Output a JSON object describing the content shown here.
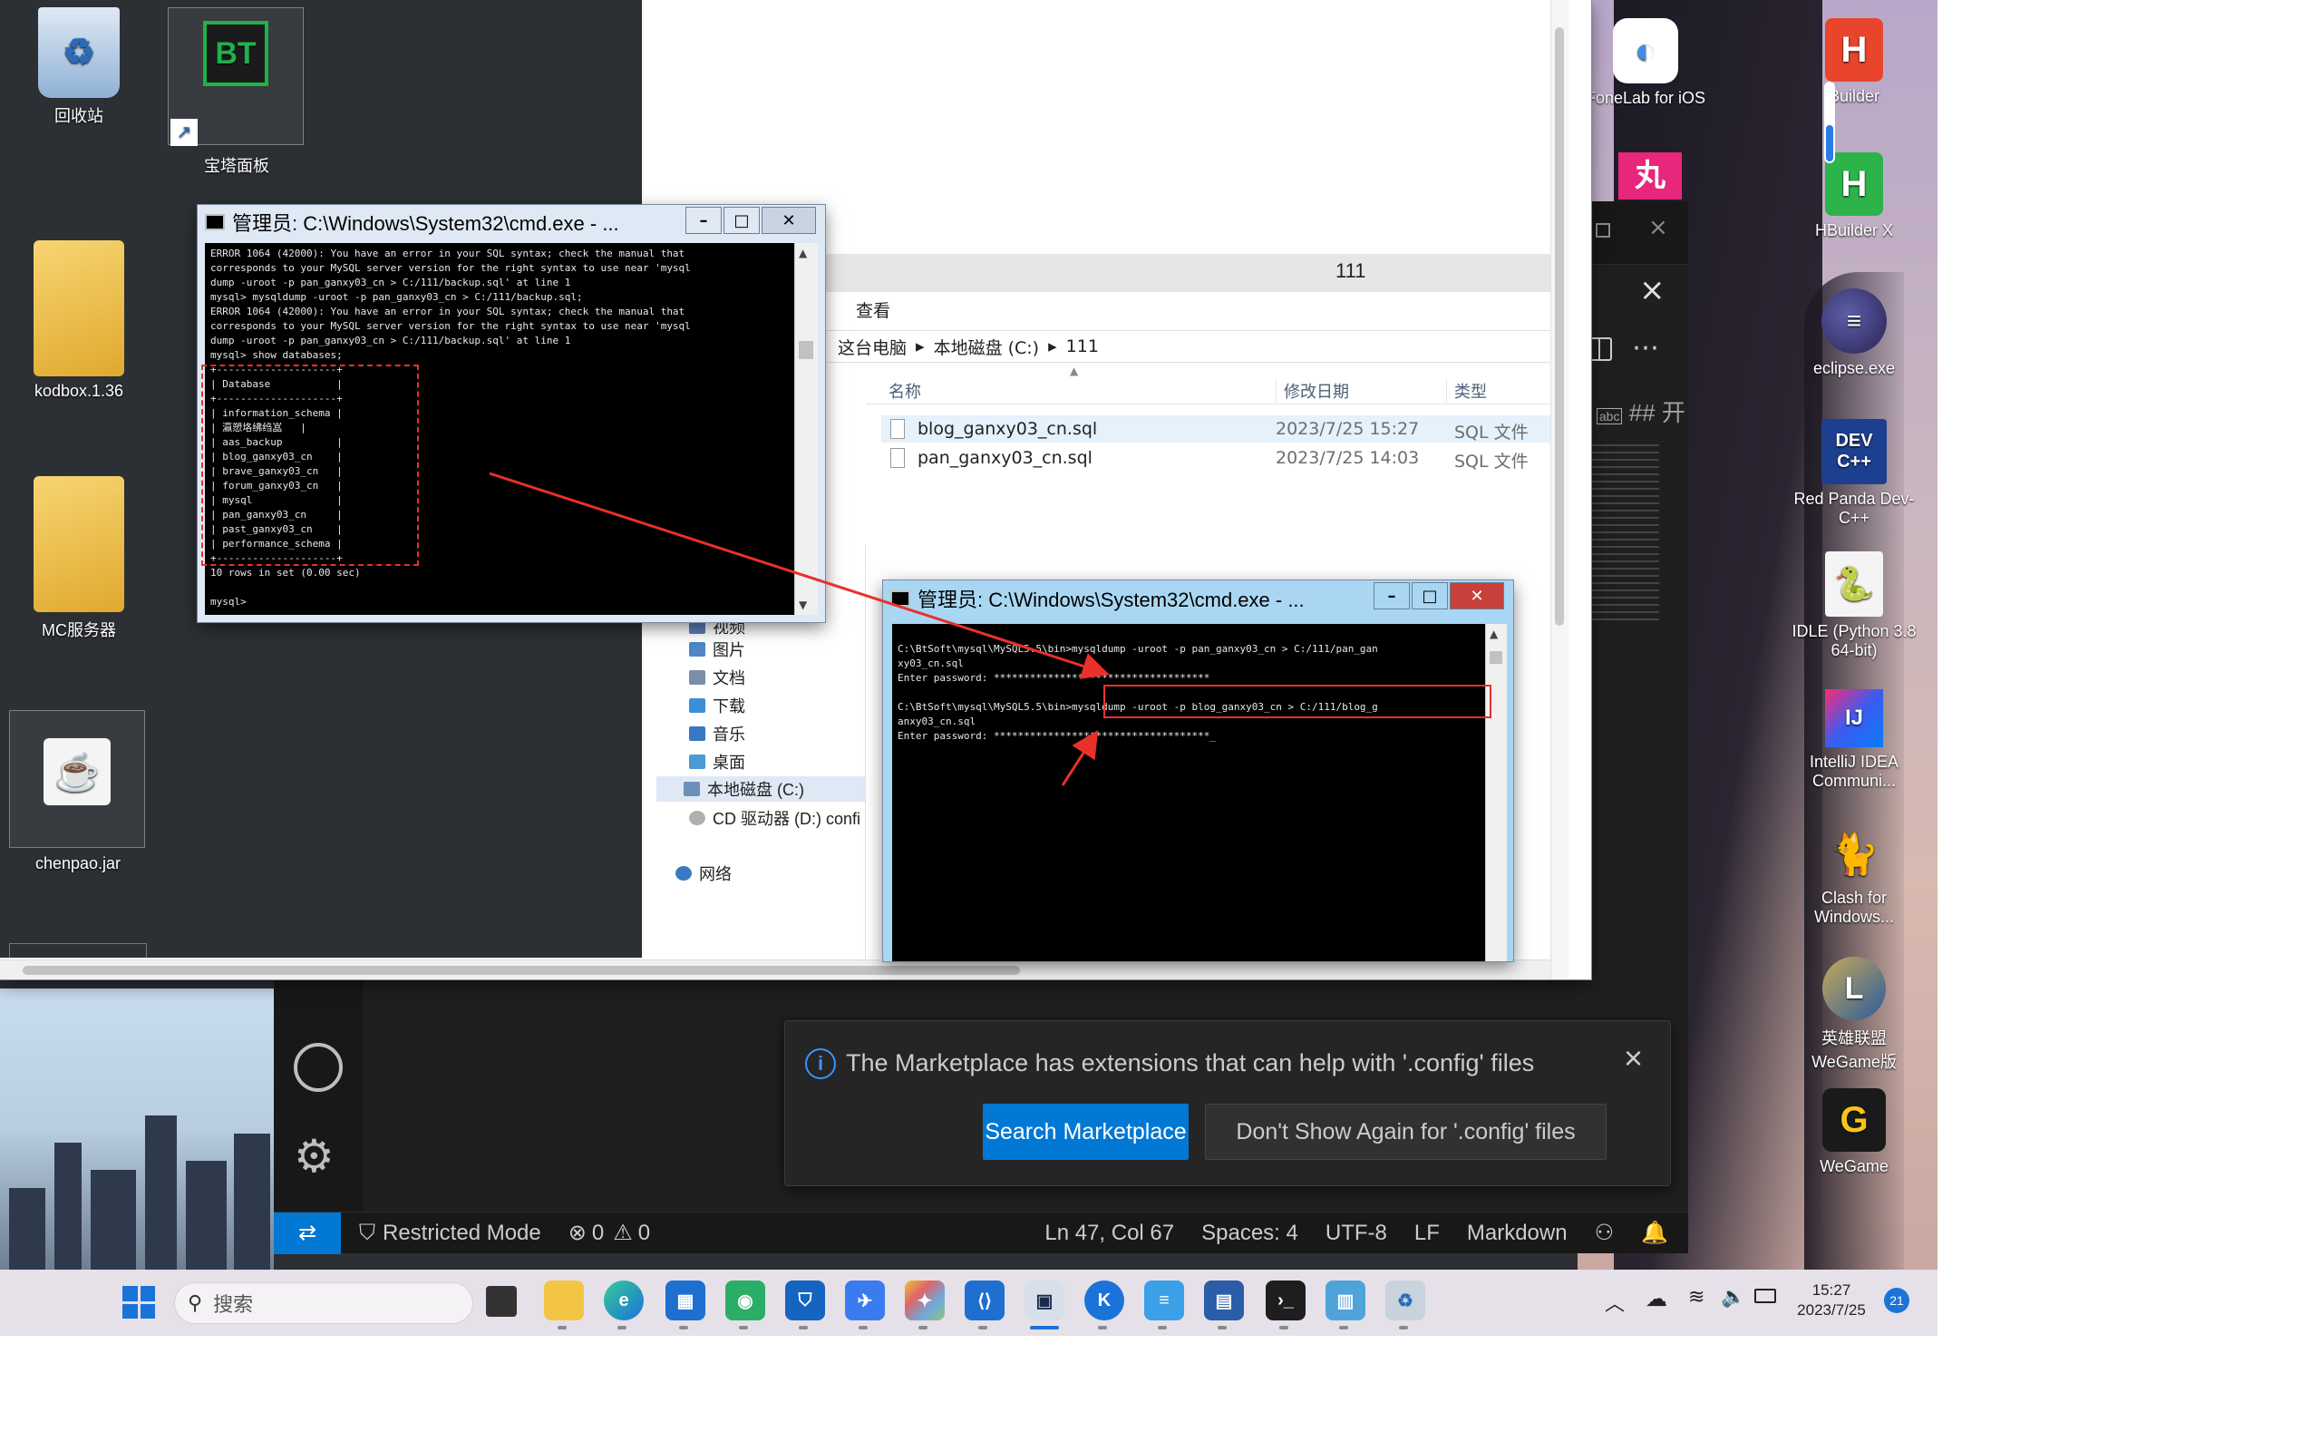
{
  "desktop_icons": {
    "recycle_bin": "回收站",
    "bt_panel": "宝塔面板",
    "bt_glyph": "BT",
    "kodbox": "kodbox.1.36",
    "mc_server": "MC服务器",
    "chenpao": "chenpao.jar",
    "fonelab": "FoneLab for iOS",
    "builder": "Builder",
    "hbuilderx": "HBuilder X",
    "eclipse": "eclipse.exe",
    "dev_glyph": "DEV C++",
    "redpanda": "Red Panda Dev-C++",
    "idle": "IDLE (Python 3.8 64-bit)",
    "ij_glyph": "IJ",
    "intellij": "IntelliJ IDEA Communi...",
    "clash": "Clash for Windows...",
    "lol": "英雄联盟 WeGame版",
    "wegame": "WeGame"
  },
  "cmd1": {
    "title": "管理员: C:\\Windows\\System32\\cmd.exe - ...",
    "lines": [
      "ERROR 1064 (42000): You have an error in your SQL syntax; check the manual that",
      "corresponds to your MySQL server version for the right syntax to use near 'mysql",
      "dump -uroot -p pan_ganxy03_cn > C:/111/backup.sql' at line 1",
      "mysql> mysqldump -uroot -p pan_ganxy03_cn > C:/111/backup.sql;",
      "ERROR 1064 (42000): You have an error in your SQL syntax; check the manual that",
      "corresponds to your MySQL server version for the right syntax to use near 'mysql",
      "dump -uroot -p pan_ganxy03_cn > C:/111/backup.sql' at line 1",
      "mysql> show databases;",
      "+--------------------+",
      "| Database           |",
      "+--------------------+",
      "| information_schema |",
      "| 瀛愬垎绋绉嵓   |",
      "| aas_backup         |",
      "| blog_ganxy03_cn    |",
      "| brave_ganxy03_cn   |",
      "| forum_ganxy03_cn   |",
      "| mysql              |",
      "| pan_ganxy03_cn     |",
      "| past_ganxy03_cn    |",
      "| performance_schema |",
      "+--------------------+",
      "10 rows in set (0.00 sec)",
      "",
      "mysql>"
    ]
  },
  "cmd2": {
    "title": "管理员: C:\\Windows\\System32\\cmd.exe - ...",
    "lines": [
      "",
      "C:\\BtSoft\\mysql\\MySQL5.5\\bin>mysqldump -uroot -p pan_ganxy03_cn > C:/111/pan_gan",
      "xy03_cn.sql",
      "Enter password: ************************************",
      "",
      "C:\\BtSoft\\mysql\\MySQL5.5\\bin>mysqldump -uroot -p blog_ganxy03_cn > C:/111/blog_g",
      "anxy03_cn.sql",
      "Enter password: ************************************_"
    ]
  },
  "explorer": {
    "title": "111",
    "menu_view": "查看",
    "breadcrumb": [
      "这台电脑",
      "本地磁盘 (C:)",
      "111"
    ],
    "columns": {
      "name": "名称",
      "date": "修改日期",
      "type": "类型"
    },
    "files": [
      {
        "name": "blog_ganxy03_cn.sql",
        "date": "2023/7/25 15:27",
        "type": "SQL 文件"
      },
      {
        "name": "pan_ganxy03_cn.sql",
        "date": "2023/7/25 14:03",
        "type": "SQL 文件"
      }
    ],
    "sidebar": [
      "视频",
      "图片",
      "文档",
      "下载",
      "音乐",
      "桌面",
      "本地磁盘 (C:)",
      "CD 驱动器 (D:) confi",
      "网络"
    ]
  },
  "vscode": {
    "heading_snippet": "## 开",
    "notification": {
      "message": "The Marketplace has extensions that can help with '.config' files",
      "primary": "Search Marketplace",
      "secondary": "Don't Show Again for '.config' files"
    },
    "status": {
      "restricted": "Restricted Mode",
      "errors": "0",
      "warnings": "0",
      "position": "Ln 47, Col 67",
      "spaces": "Spaces: 4",
      "encoding": "UTF-8",
      "eol": "LF",
      "language": "Markdown"
    }
  },
  "taskbar": {
    "search_placeholder": "搜索",
    "time": "15:27",
    "date": "2023/7/25",
    "notif_count": "21"
  },
  "colors": {
    "vscode_blue": "#0078d4",
    "annotation_red": "#e8312a",
    "cmd_title_bg": "#dfe9f5",
    "cmd2_title_bg": "#a9d7f3"
  }
}
